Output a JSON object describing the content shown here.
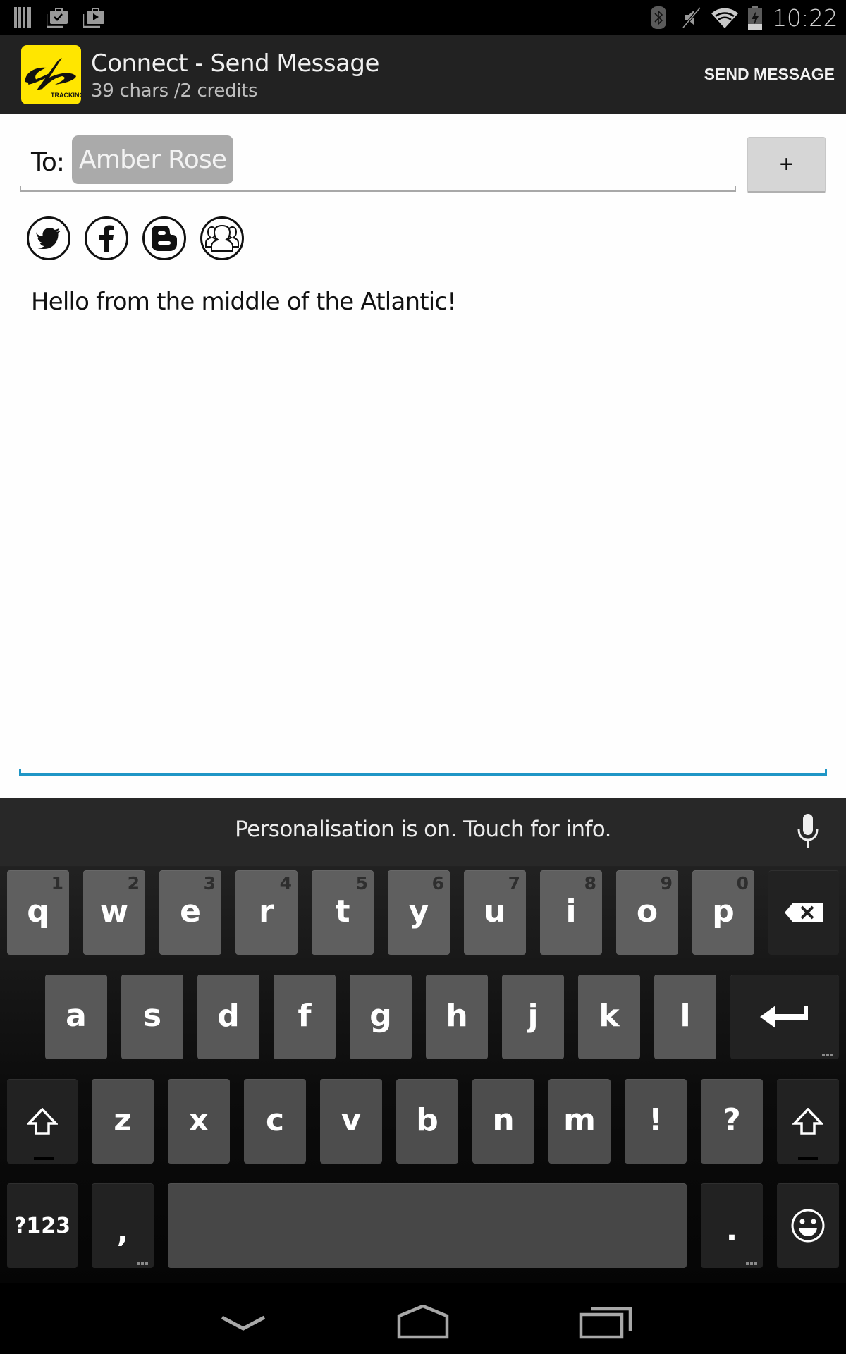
{
  "status_bar": {
    "time": "10:22",
    "left_icons": [
      "barcode-icon",
      "store-check-icon",
      "store-play-icon"
    ],
    "right_icons": [
      "bluetooth-icon",
      "muted-icon",
      "wifi-icon",
      "battery-charging-icon"
    ]
  },
  "action_bar": {
    "title": "Connect - Send Message",
    "subtitle": "39 chars /2 credits",
    "logo_text": "TRACKING",
    "send_label": "SEND MESSAGE",
    "logo_color": "#ffe600"
  },
  "compose": {
    "to_label": "To:",
    "recipient": "Amber Rose",
    "add_recipient_label": "+",
    "social_buttons": [
      "twitter",
      "facebook",
      "blogger",
      "group"
    ],
    "message": "Hello from the middle of the Atlantic!",
    "accent_color": "#1f96c6"
  },
  "keyboard": {
    "suggestion_text": "Personalisation is on. Touch for info.",
    "row1": [
      {
        "key": "q",
        "hint": "1"
      },
      {
        "key": "w",
        "hint": "2"
      },
      {
        "key": "e",
        "hint": "3"
      },
      {
        "key": "r",
        "hint": "4"
      },
      {
        "key": "t",
        "hint": "5"
      },
      {
        "key": "y",
        "hint": "6"
      },
      {
        "key": "u",
        "hint": "7"
      },
      {
        "key": "i",
        "hint": "8"
      },
      {
        "key": "o",
        "hint": "9"
      },
      {
        "key": "p",
        "hint": "0"
      }
    ],
    "row2": [
      "a",
      "s",
      "d",
      "f",
      "g",
      "h",
      "j",
      "k",
      "l"
    ],
    "row3": [
      "z",
      "x",
      "c",
      "v",
      "b",
      "n",
      "m",
      "!",
      "?"
    ],
    "symbols_label": "?123",
    "comma_label": ",",
    "period_label": "."
  },
  "nav_bar": {
    "buttons": [
      "back-icon",
      "home-icon",
      "recents-icon"
    ]
  }
}
